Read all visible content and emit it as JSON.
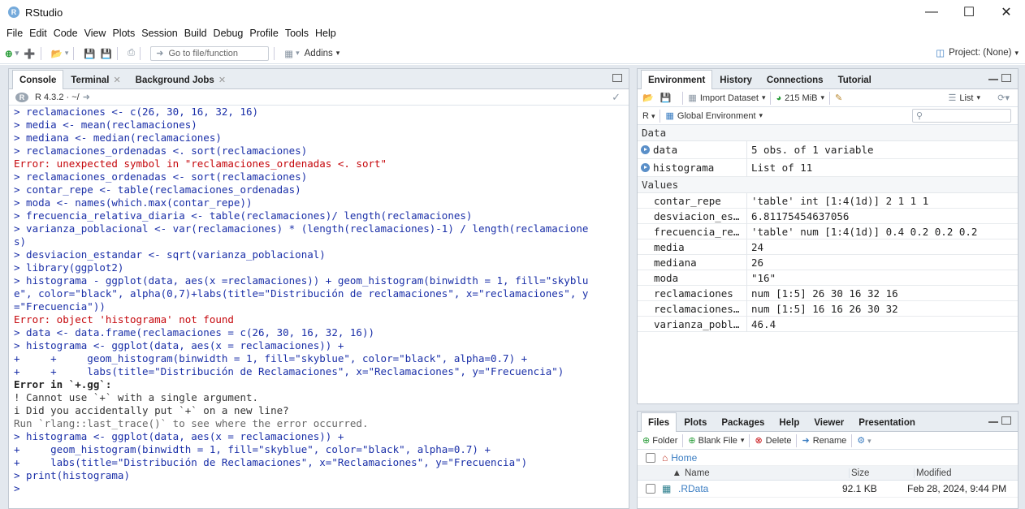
{
  "window": {
    "title": "RStudio"
  },
  "menu": [
    "File",
    "Edit",
    "Code",
    "View",
    "Plots",
    "Session",
    "Build",
    "Debug",
    "Profile",
    "Tools",
    "Help"
  ],
  "toolbar": {
    "goto": "Go to file/function",
    "addins": "Addins",
    "project": "Project: (None)"
  },
  "console_pane": {
    "tabs": [
      {
        "label": "Console"
      },
      {
        "label": "Terminal"
      },
      {
        "label": "Background Jobs"
      }
    ],
    "r_version": "R 4.3.2 · ~/",
    "lines": [
      {
        "t": "cmd",
        "text": "> reclamaciones <- c(26, 30, 16, 32, 16)"
      },
      {
        "t": "cmd",
        "text": "> media <- mean(reclamaciones)"
      },
      {
        "t": "cmd",
        "text": "> mediana <- median(reclamaciones)"
      },
      {
        "t": "cmd",
        "text": "> reclamaciones_ordenadas <. sort(reclamaciones)"
      },
      {
        "t": "err",
        "text": "Error: unexpected symbol in \"reclamaciones_ordenadas <. sort\""
      },
      {
        "t": "cmd",
        "text": "> reclamaciones_ordenadas <- sort(reclamaciones)"
      },
      {
        "t": "cmd",
        "text": "> contar_repe <- table(reclamaciones_ordenadas)"
      },
      {
        "t": "cmd",
        "text": "> moda <- names(which.max(contar_repe))"
      },
      {
        "t": "cmd",
        "text": "> frecuencia_relativa_diaria <- table(reclamaciones)/ length(reclamaciones)"
      },
      {
        "t": "cmd",
        "text": "> varianza_poblacional <- var(reclamaciones) * (length(reclamaciones)-1) / length(reclamacione"
      },
      {
        "t": "cmd",
        "text": "s)"
      },
      {
        "t": "cmd",
        "text": "> desviacion_estandar <- sqrt(varianza_poblacional)"
      },
      {
        "t": "cmd",
        "text": "> library(ggplot2)"
      },
      {
        "t": "cmd",
        "text": "> histograma - ggplot(data, aes(x =reclamaciones)) + geom_histogram(binwidth = 1, fill=\"skyblu"
      },
      {
        "t": "cmd",
        "text": "e\", color=\"black\", alpha(0,7)+labs(title=\"Distribución de reclamaciones\", x=\"reclamaciones\", y"
      },
      {
        "t": "cmd",
        "text": "=\"Frecuencia\"))"
      },
      {
        "t": "err",
        "text": "Error: object 'histograma' not found"
      },
      {
        "t": "cmd",
        "text": "> data <- data.frame(reclamaciones = c(26, 30, 16, 32, 16))"
      },
      {
        "t": "cmd",
        "text": "> histograma <- ggplot(data, aes(x = reclamaciones)) +"
      },
      {
        "t": "cmd",
        "text": "+     +     geom_histogram(binwidth = 1, fill=\"skyblue\", color=\"black\", alpha=0.7) +"
      },
      {
        "t": "cmd",
        "text": "+     +     labs(title=\"Distribución de Reclamaciones\", x=\"Reclamaciones\", y=\"Frecuencia\")"
      },
      {
        "t": "errh",
        "text": "Error in `+.gg`:"
      },
      {
        "t": "msg",
        "text": "! Cannot use `+` with a single argument."
      },
      {
        "t": "msg",
        "text": "i Did you accidentally put `+` on a new line?"
      },
      {
        "t": "trace",
        "text": "Run `rlang::last_trace()` to see where the error occurred."
      },
      {
        "t": "cmd",
        "text": "> histograma <- ggplot(data, aes(x = reclamaciones)) +"
      },
      {
        "t": "cmd",
        "text": "+     geom_histogram(binwidth = 1, fill=\"skyblue\", color=\"black\", alpha=0.7) +"
      },
      {
        "t": "cmd",
        "text": "+     labs(title=\"Distribución de Reclamaciones\", x=\"Reclamaciones\", y=\"Frecuencia\")"
      },
      {
        "t": "cmd",
        "text": "> print(histograma)"
      },
      {
        "t": "cmd",
        "text": ">"
      }
    ]
  },
  "env_pane": {
    "tabs": [
      {
        "label": "Environment"
      },
      {
        "label": "History"
      },
      {
        "label": "Connections"
      },
      {
        "label": "Tutorial"
      }
    ],
    "import": "Import Dataset",
    "memory": "215 MiB",
    "view": "List",
    "lang": "R",
    "scope": "Global Environment",
    "data_label": "Data",
    "data": [
      {
        "name": "data",
        "value": "5 obs. of 1 variable"
      },
      {
        "name": "histograma",
        "value": "List of  11"
      }
    ],
    "values_label": "Values",
    "values": [
      {
        "name": "contar_repe",
        "value": "'table' int [1:4(1d)] 2 1 1 1"
      },
      {
        "name": "desviacion_es…",
        "value": "6.81175454637056"
      },
      {
        "name": "frecuencia_re…",
        "value": "'table' num [1:4(1d)] 0.4 0.2 0.2 0.2"
      },
      {
        "name": "media",
        "value": "24"
      },
      {
        "name": "mediana",
        "value": "26"
      },
      {
        "name": "moda",
        "value": "\"16\""
      },
      {
        "name": "reclamaciones",
        "value": "num [1:5] 26 30 16 32 16"
      },
      {
        "name": "reclamaciones…",
        "value": "num [1:5] 16 16 26 30 32"
      },
      {
        "name": "varianza_pobl…",
        "value": "46.4"
      }
    ]
  },
  "files_pane": {
    "tabs": [
      {
        "label": "Files"
      },
      {
        "label": "Plots"
      },
      {
        "label": "Packages"
      },
      {
        "label": "Help"
      },
      {
        "label": "Viewer"
      },
      {
        "label": "Presentation"
      }
    ],
    "folder": "Folder",
    "blank": "Blank File",
    "delete": "Delete",
    "rename": "Rename",
    "home": "Home",
    "cols": {
      "name": "Name",
      "size": "Size",
      "modified": "Modified"
    },
    "files": [
      {
        "name": ".RData",
        "size": "92.1 KB",
        "modified": "Feb 28, 2024, 9:44 PM"
      }
    ]
  }
}
